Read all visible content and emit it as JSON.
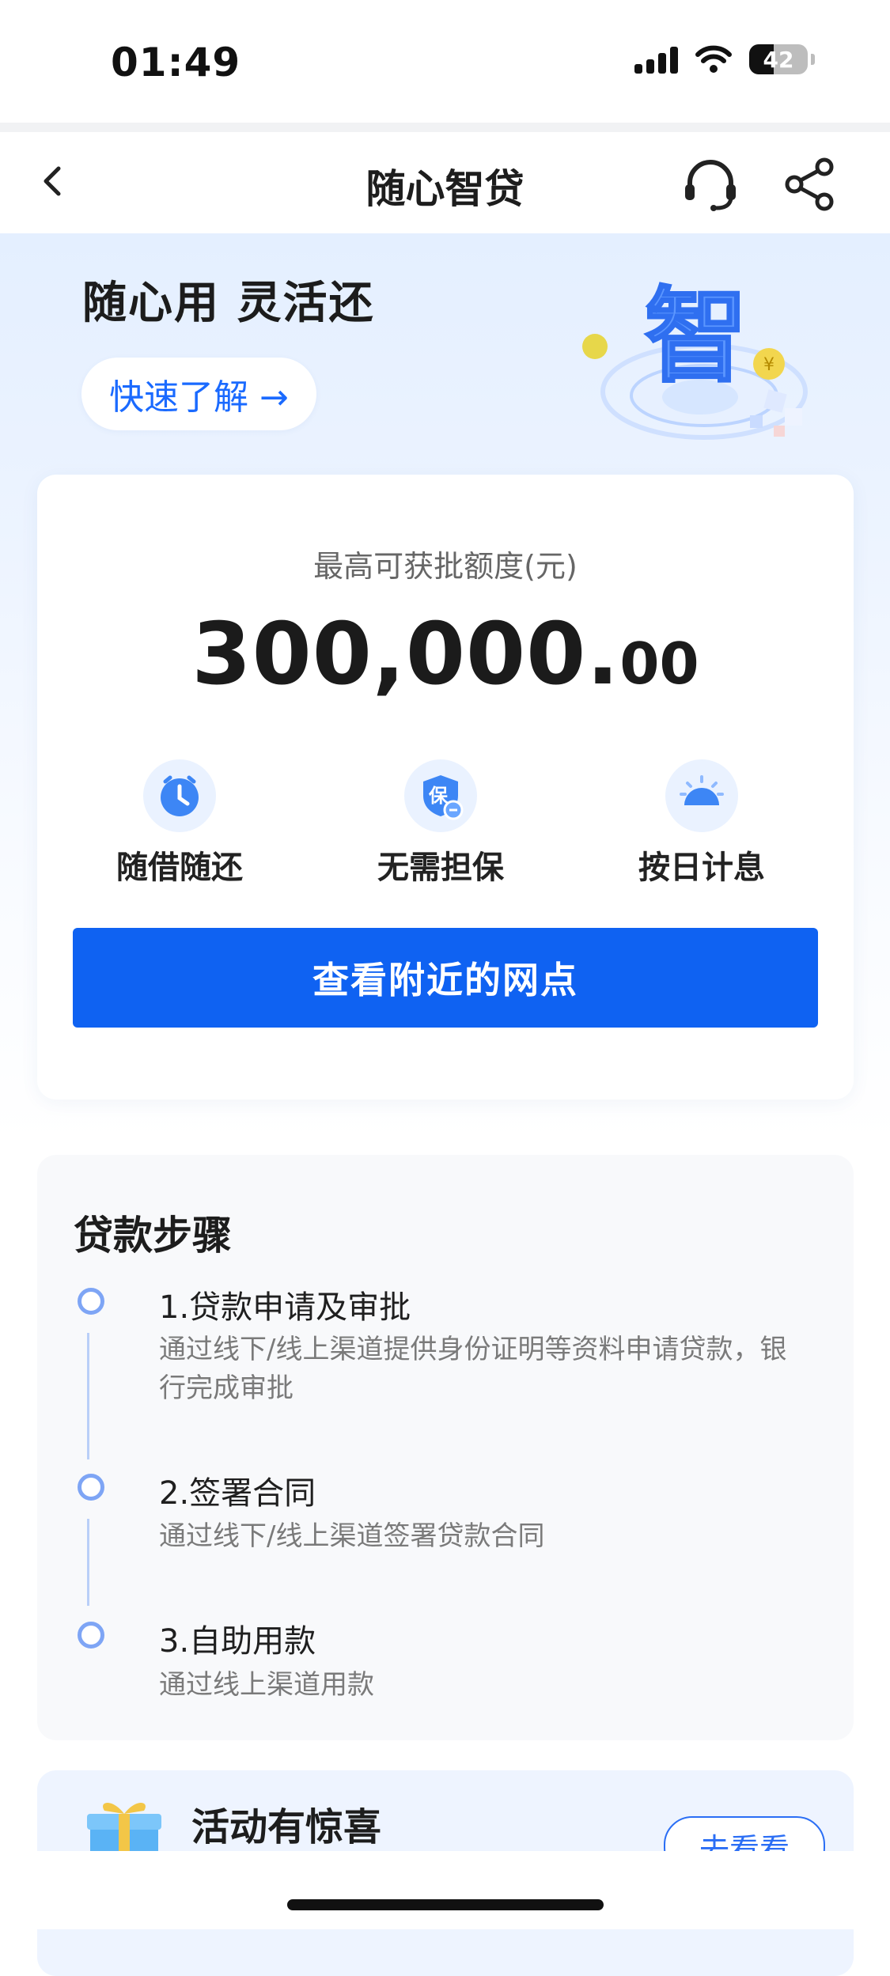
{
  "status_bar": {
    "time": "01:49",
    "battery": "42"
  },
  "nav": {
    "title": "随心智贷"
  },
  "hero": {
    "slogan": "随心用 灵活还",
    "learn_more": "快速了解 →",
    "art_char": "智"
  },
  "quota": {
    "label": "最高可获批额度(元)",
    "amount_int": "300,000.",
    "amount_dec": "00"
  },
  "features": [
    {
      "label": "随借随还",
      "icon": "clock-icon"
    },
    {
      "label": "无需担保",
      "icon": "guarantee-shield-icon",
      "glyph": "保"
    },
    {
      "label": "按日计息",
      "icon": "sun-icon"
    }
  ],
  "primary_button": "查看附近的网点",
  "steps": {
    "title": "贷款步骤",
    "items": [
      {
        "title": "1.贷款申请及审批",
        "desc": "通过线下/线上渠道提供身份证明等资料申请贷款，银行完成审批"
      },
      {
        "title": "2.签署合同",
        "desc": "通过线下/线上渠道签署贷款合同"
      },
      {
        "title": "3.自助用款",
        "desc": "通过线上渠道用款"
      }
    ]
  },
  "promo": {
    "title": "活动有惊喜",
    "button": "去看看"
  },
  "colors": {
    "accent": "#0f62f2",
    "hero_bg": "#e4efff",
    "step_dot": "#7ea5f5"
  }
}
